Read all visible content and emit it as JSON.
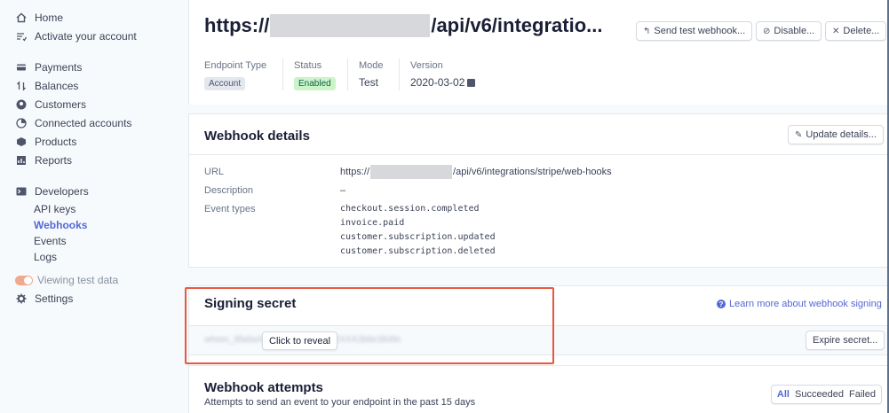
{
  "sidebar": {
    "home": "Home",
    "activate": "Activate your account",
    "payments": "Payments",
    "balances": "Balances",
    "customers": "Customers",
    "connected": "Connected accounts",
    "products": "Products",
    "reports": "Reports",
    "developers": "Developers",
    "sub": {
      "api_keys": "API keys",
      "webhooks": "Webhooks",
      "events": "Events",
      "logs": "Logs"
    },
    "test_data": "Viewing test data",
    "settings": "Settings"
  },
  "header": {
    "title_prefix": "https://",
    "title_suffix": "/api/v6/integratio...",
    "send_test": "Send test webhook...",
    "disable": "Disable...",
    "delete": "Delete...",
    "meta": {
      "endpoint_type_label": "Endpoint Type",
      "endpoint_type_value": "Account",
      "status_label": "Status",
      "status_value": "Enabled",
      "mode_label": "Mode",
      "mode_value": "Test",
      "version_label": "Version",
      "version_value": "2020-03-02"
    }
  },
  "details": {
    "title": "Webhook details",
    "update_button": "Update details...",
    "url_label": "URL",
    "url_prefix": "https://",
    "url_suffix": "/api/v6/integrations/stripe/web-hooks",
    "description_label": "Description",
    "description_value": "–",
    "events_label": "Event types",
    "events": [
      "checkout.session.completed",
      "invoice.paid",
      "customer.subscription.updated",
      "customer.subscription.deleted"
    ]
  },
  "signing": {
    "title": "Signing secret",
    "learn_more": "Learn more about webhook signing",
    "click_to_reveal": "Click to reveal",
    "expire_button": "Expire secret..."
  },
  "attempts": {
    "title": "Webhook attempts",
    "subtitle": "Attempts to send an event to your endpoint in the past 15 days",
    "filters": [
      "All",
      "Succeeded",
      "Failed"
    ]
  },
  "colors": {
    "accent": "#5469d4",
    "highlight": "#e8583f",
    "enabled_bg": "#cbf4c9"
  }
}
